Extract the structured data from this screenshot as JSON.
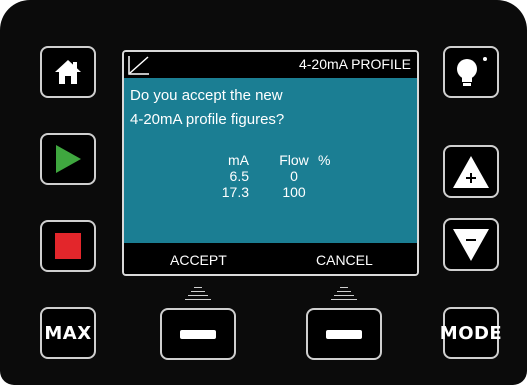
{
  "screen": {
    "title": "4-20mA PROFILE",
    "message_line1": "Do you accept the new",
    "message_line2": "4-20mA profile figures?",
    "table": {
      "headers": [
        "mA",
        "Flow",
        "%"
      ],
      "rows": [
        {
          "ma": "6.5",
          "flow": "0"
        },
        {
          "ma": "17.3",
          "flow": "100"
        }
      ]
    },
    "softkeys": {
      "left": "ACCEPT",
      "right": "CANCEL"
    }
  },
  "buttons": {
    "max_label": "MAX",
    "mode_label": "MODE"
  },
  "colors": {
    "panel": "#1b7e93",
    "play": "#3fa73f",
    "stop": "#e3262b"
  }
}
